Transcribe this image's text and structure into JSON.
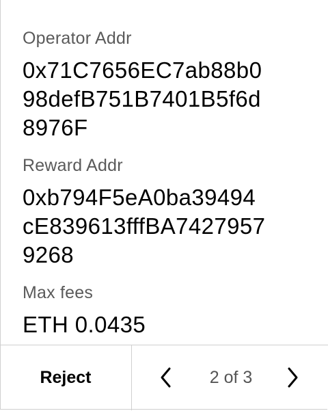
{
  "fields": [
    {
      "label": "Operator Addr",
      "value_lines": [
        "0x71C7656EC7ab88b0",
        "98defB751B7401B5f6d",
        "8976F"
      ]
    },
    {
      "label": "Reward Addr",
      "value_lines": [
        "0xb794F5eA0ba39494",
        "cE839613fffBA7427957",
        "9268"
      ]
    },
    {
      "label": "Max fees",
      "value_lines": [
        "ETH 0.0435"
      ]
    }
  ],
  "footer": {
    "reject_label": "Reject",
    "page_indicator": "2 of 3",
    "prev_icon": "chevron-left-icon",
    "next_icon": "chevron-right-icon"
  }
}
